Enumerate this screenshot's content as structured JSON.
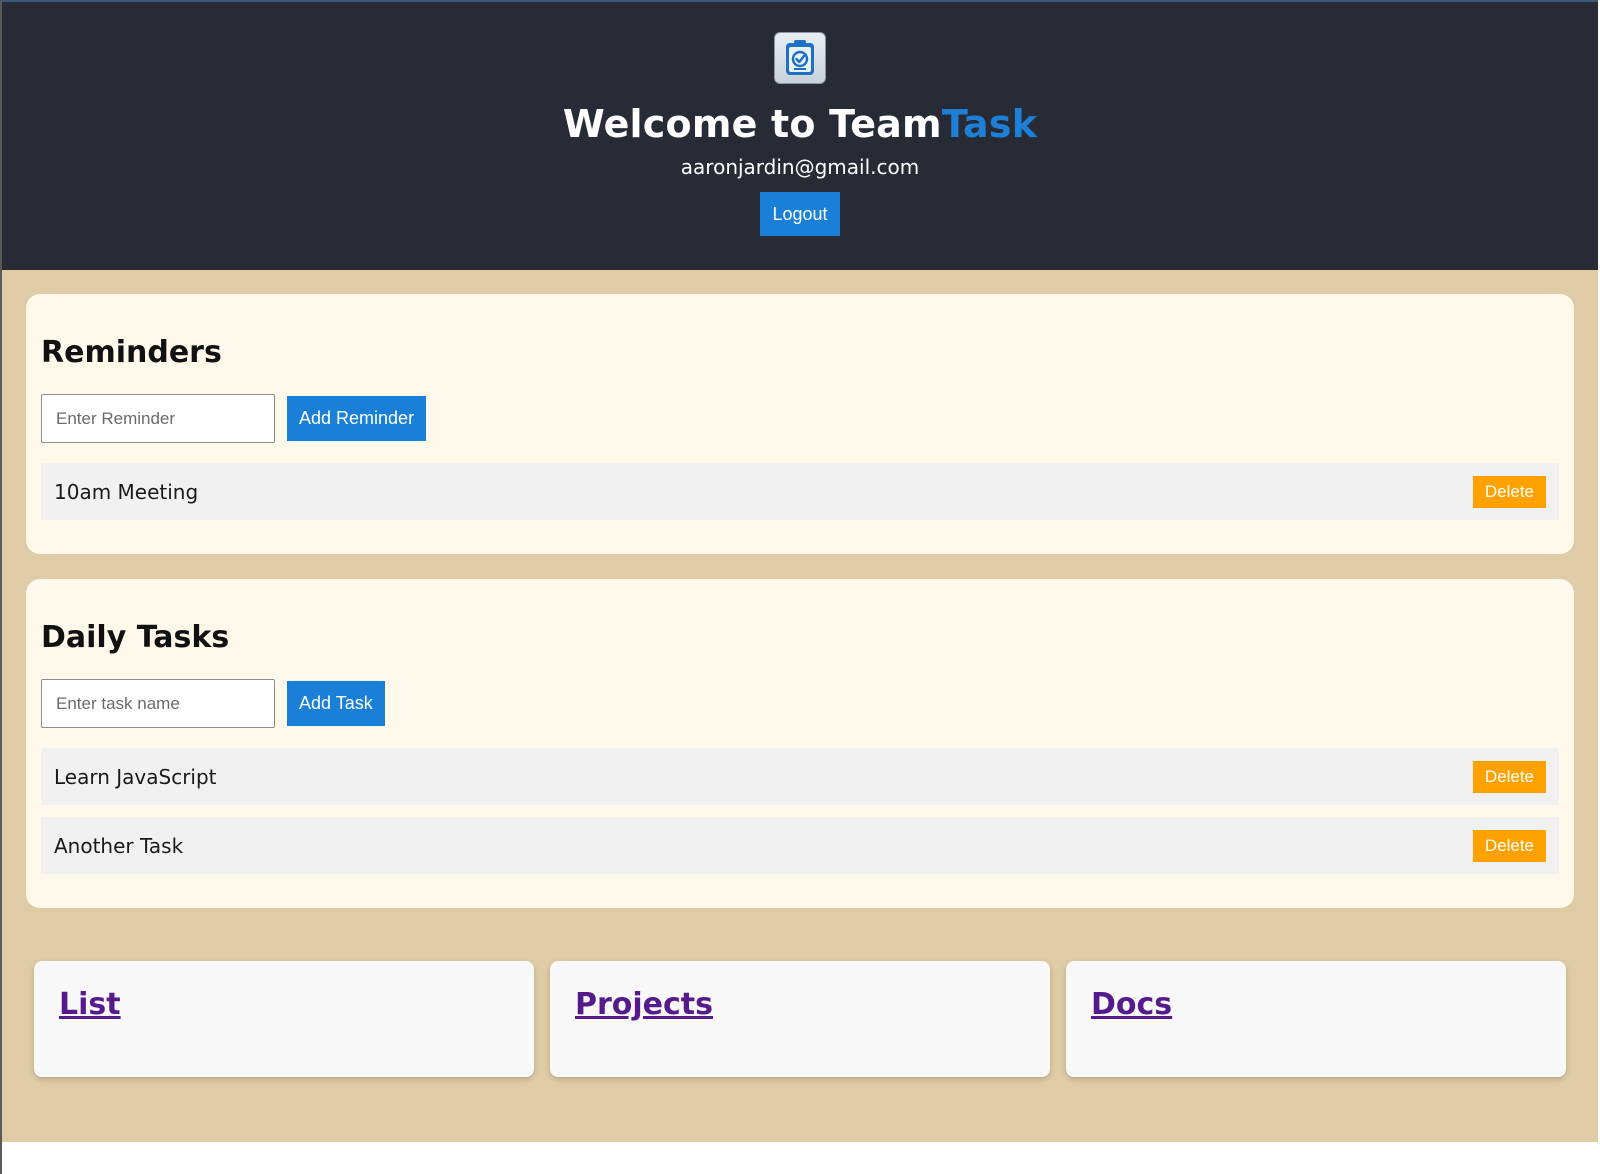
{
  "header": {
    "title_prefix": "Welcome to Team",
    "title_accent": "Task",
    "email": "aaronjardin@gmail.com",
    "logout_label": "Logout",
    "logo_icon": "clipboard-check-icon"
  },
  "reminders": {
    "heading": "Reminders",
    "input_placeholder": "Enter Reminder",
    "input_value": "",
    "add_label": "Add Reminder",
    "items": [
      {
        "text": "10am Meeting",
        "delete_label": "Delete"
      }
    ]
  },
  "tasks": {
    "heading": "Daily Tasks",
    "input_placeholder": "Enter task name",
    "input_value": "",
    "add_label": "Add Task",
    "items": [
      {
        "text": "Learn JavaScript",
        "delete_label": "Delete"
      },
      {
        "text": "Another Task",
        "delete_label": "Delete"
      }
    ]
  },
  "links": [
    {
      "label": "List"
    },
    {
      "label": "Projects"
    },
    {
      "label": "Docs"
    }
  ],
  "colors": {
    "header_bg": "#262b36",
    "accent_blue": "#1a7fd6",
    "main_bg": "#dfcba5",
    "card_bg": "#fff9ec",
    "delete_orange": "#ffa200",
    "link_purple": "#551a8b"
  }
}
